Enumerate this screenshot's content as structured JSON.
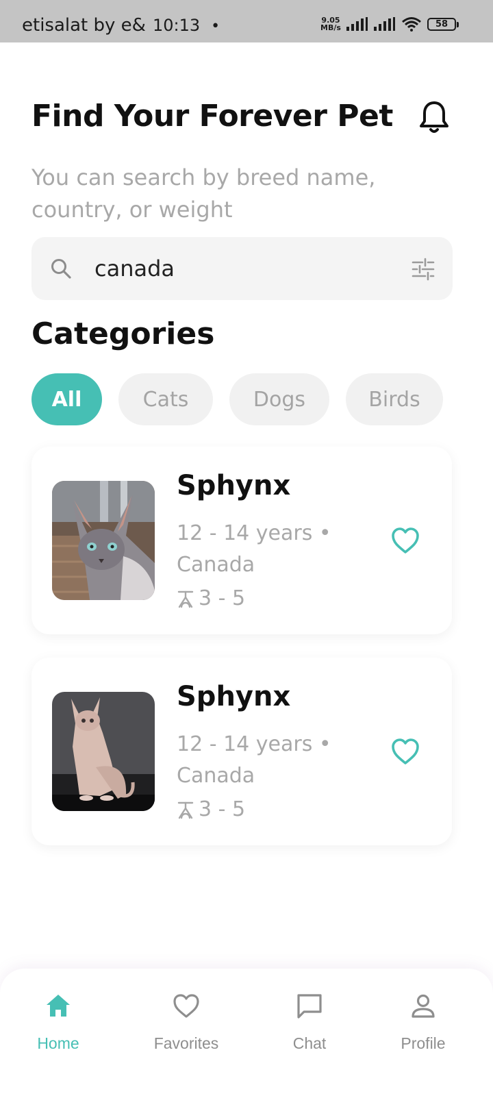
{
  "status_bar": {
    "carrier": "etisalat by e&",
    "time": "10:13",
    "dot": "•",
    "net_speed_value": "9.05",
    "net_speed_unit": "MB/s",
    "battery": "58"
  },
  "header": {
    "title": "Find Your Forever Pet",
    "subtitle": "You can search by breed name, country, or weight"
  },
  "search": {
    "value": "canada",
    "placeholder": "Search"
  },
  "categories": {
    "title": "Categories",
    "chips": [
      {
        "label": "All",
        "active": true
      },
      {
        "label": "Cats",
        "active": false
      },
      {
        "label": "Dogs",
        "active": false
      },
      {
        "label": "Birds",
        "active": false
      }
    ]
  },
  "pets": [
    {
      "name": "Sphynx",
      "meta": "12 - 14 years • Canada",
      "weight": "3 - 5"
    },
    {
      "name": "Sphynx",
      "meta": "12 - 14 years • Canada",
      "weight": "3 - 5"
    }
  ],
  "nav": {
    "items": [
      {
        "label": "Home",
        "icon": "home-icon",
        "active": true
      },
      {
        "label": "Favorites",
        "icon": "heart-icon",
        "active": false
      },
      {
        "label": "Chat",
        "icon": "chat-icon",
        "active": false
      },
      {
        "label": "Profile",
        "icon": "person-icon",
        "active": false
      }
    ]
  },
  "colors": {
    "accent": "#46bfb4",
    "muted_text": "#a8a8a8",
    "chip_bg": "#f1f1f1",
    "status_bar_bg": "#c4c4c4"
  }
}
